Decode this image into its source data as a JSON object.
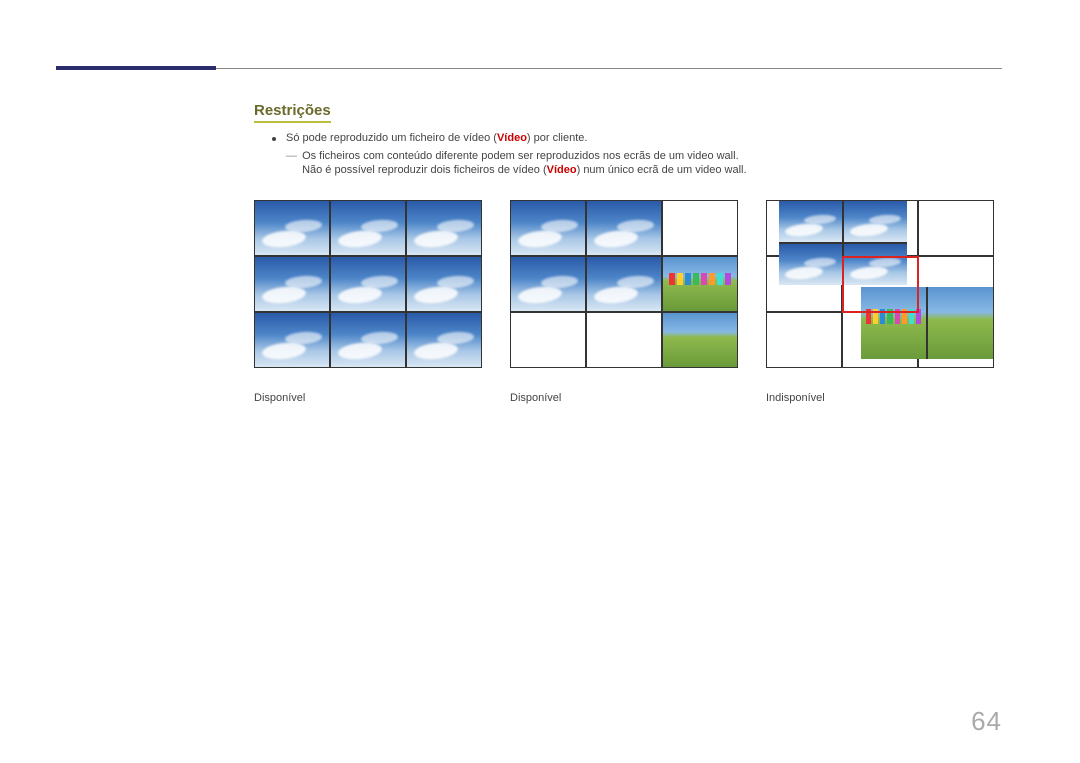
{
  "heading": "Restrições",
  "bullet": {
    "pre": "Só pode reproduzido um ficheiro de vídeo (",
    "video": "Vídeo",
    "post": ") por cliente."
  },
  "sub": {
    "line1": "Os ficheiros com conteúdo diferente podem ser reproduzidos nos ecrãs de um video wall.",
    "line2_pre": "Não é possível reproduzir dois ficheiros de vídeo (",
    "line2_video": "Vídeo",
    "line2_post": ") num único ecrã de um video wall."
  },
  "captions": {
    "c1": "Disponível",
    "c2": "Disponível",
    "c3": "Indisponível"
  },
  "page_number": "64"
}
